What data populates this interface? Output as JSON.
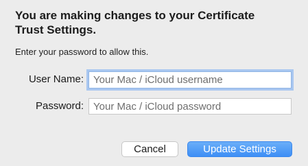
{
  "dialog": {
    "title": "You are making changes to your Certificate Trust Settings.",
    "subtitle": "Enter your password to allow this."
  },
  "form": {
    "user_label": "User Name:",
    "user_placeholder": "Your Mac / iCloud username",
    "password_label": "Password:",
    "password_placeholder": "Your Mac / iCloud password"
  },
  "buttons": {
    "cancel_label": "Cancel",
    "update_label": "Update Settings"
  },
  "colors": {
    "background": "#ececec",
    "focus_ring": "#a9c7f0",
    "primary_button": "#3e8ff5"
  }
}
